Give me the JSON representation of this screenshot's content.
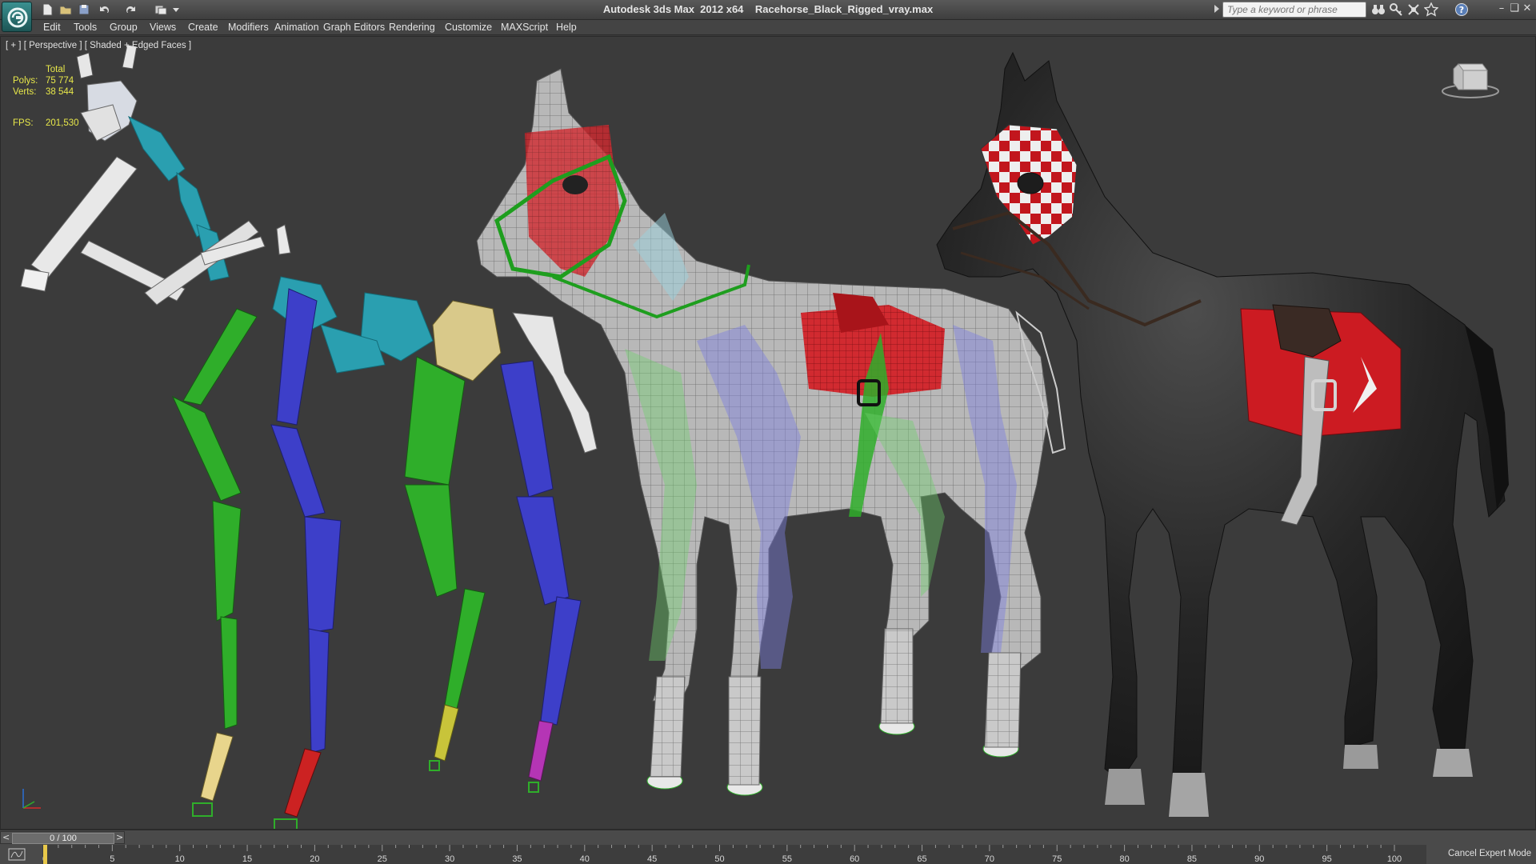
{
  "window": {
    "app_title": "Autodesk 3ds Max  2012 x64",
    "file_name": "Racehorse_Black_Rigged_vray.max"
  },
  "search": {
    "placeholder": "Type a keyword or phrase"
  },
  "menu": [
    "Edit",
    "Tools",
    "Group",
    "Views",
    "Create",
    "Modifiers",
    "Animation",
    "Graph Editors",
    "Rendering",
    "Customize",
    "MAXScript",
    "Help"
  ],
  "viewport": {
    "label": "[ + ] [ Perspective ] [ Shaded + Edged Faces ]",
    "stats": {
      "total_label": "Total",
      "polys_label": "Polys:",
      "polys_value": "75 774",
      "verts_label": "Verts:",
      "verts_value": "38 544",
      "fps_label": "FPS:",
      "fps_value": "201,530"
    }
  },
  "timeline": {
    "left_arrow": "<",
    "frame_display": "0 / 100",
    "right_arrow": ">",
    "tick_labels": [
      "0",
      "5",
      "10",
      "15",
      "20",
      "25",
      "30",
      "35",
      "40",
      "45",
      "50",
      "55",
      "60",
      "65",
      "70",
      "75",
      "80",
      "85",
      "90",
      "95",
      "100"
    ],
    "current_frame": 0,
    "frame_count": 100
  },
  "status": {
    "cancel_expert_mode": "Cancel Expert Mode"
  },
  "colors": {
    "viewport_bg": "#3b3b3b",
    "stats_text": "#e8e84a",
    "bone_green": "#2fae2a",
    "bone_blue": "#3d3fc9",
    "bone_cyan": "#2a9fb0",
    "bone_white": "#d9d9d9",
    "saddle_red": "#cc1b22",
    "horse_black": "#222222"
  }
}
